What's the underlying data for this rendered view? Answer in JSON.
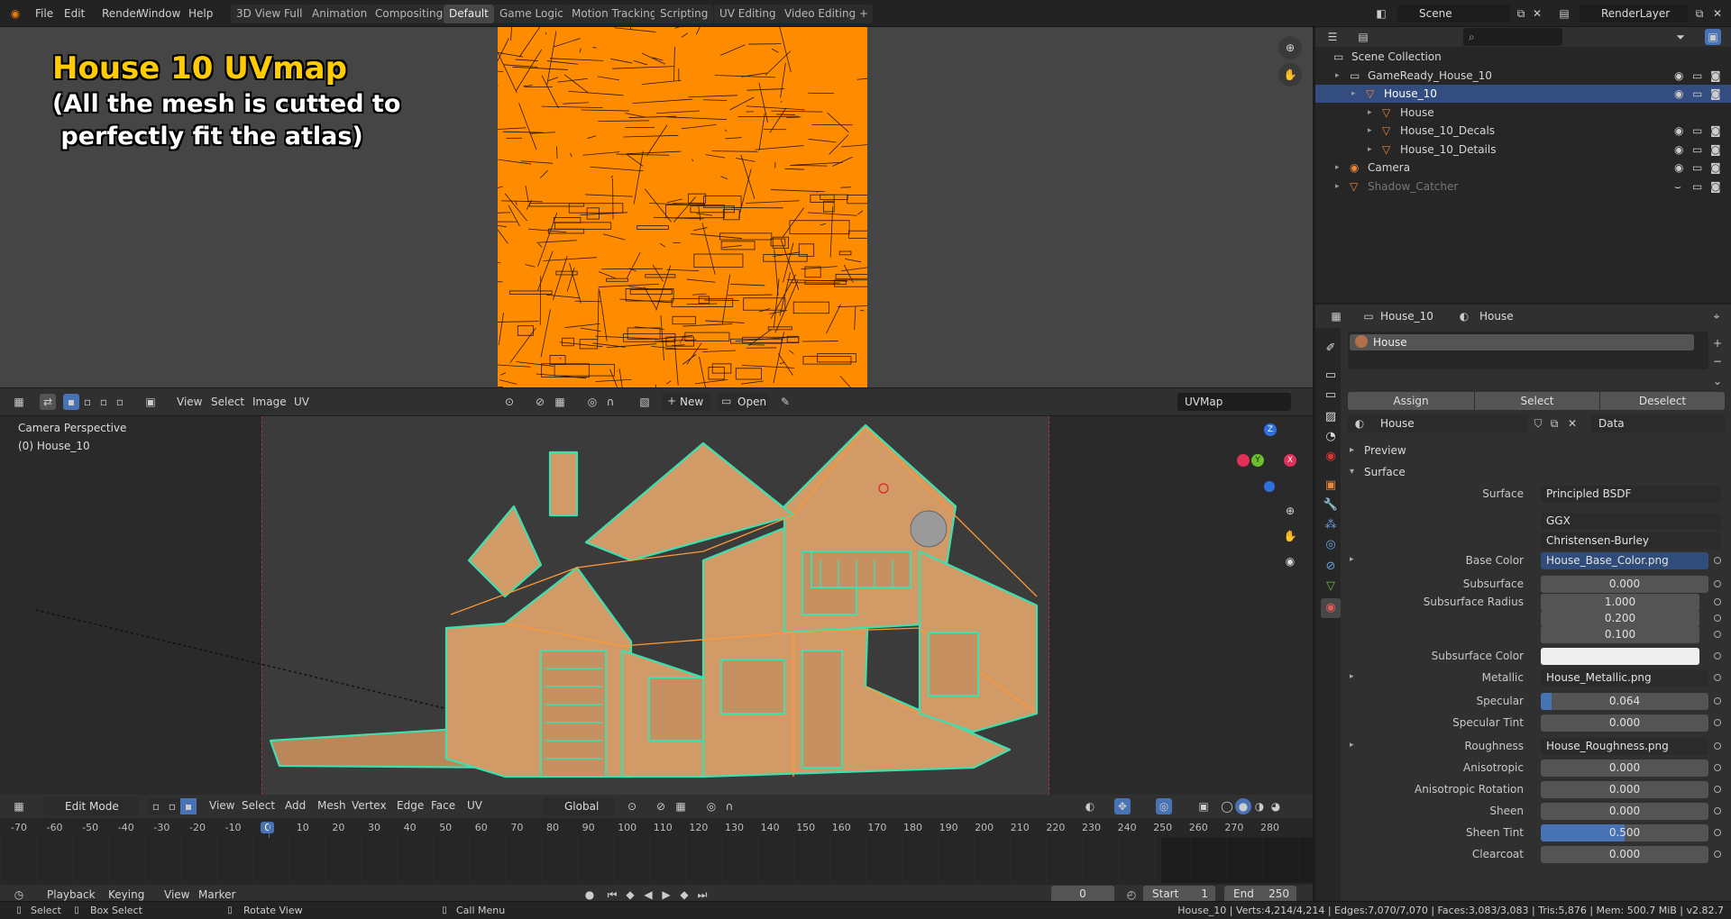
{
  "topbar": {
    "menus": [
      "File",
      "Edit",
      "Render",
      "Window",
      "Help"
    ],
    "workspaces": [
      "3D View Full",
      "Animation",
      "Compositing",
      "Default",
      "Game Logic",
      "Motion Tracking",
      "Scripting",
      "UV Editing",
      "Video Editing"
    ],
    "active_workspace": "Default",
    "add_workspace": "+",
    "scene": "Scene",
    "render_layer": "RenderLayer"
  },
  "overlay": {
    "title": "House 10 UVmap",
    "line1": "(All the mesh is cutted to",
    "line2": " perfectly fit the atlas)"
  },
  "uv_header": {
    "menus": [
      "View",
      "Select",
      "Image",
      "UV"
    ],
    "new_label": "New",
    "open_label": "Open",
    "uvmap": "UVMap"
  },
  "viewport": {
    "view_name": "Camera Perspective",
    "object_name": "(0) House_10",
    "gizmo_axes": [
      "Z",
      "Y",
      "X"
    ]
  },
  "vp_header": {
    "mode": "Edit Mode",
    "menus": [
      "View",
      "Select",
      "Add",
      "Mesh",
      "Vertex",
      "Edge",
      "Face",
      "UV"
    ],
    "orientation": "Global"
  },
  "timeline": {
    "ticks": [
      "-70",
      "-60",
      "-50",
      "-40",
      "-30",
      "-20",
      "-10",
      "0",
      "10",
      "20",
      "30",
      "40",
      "50",
      "60",
      "70",
      "80",
      "90",
      "100",
      "110",
      "120",
      "130",
      "140",
      "150",
      "160",
      "170",
      "180",
      "190",
      "200",
      "210",
      "220",
      "230",
      "240",
      "250",
      "260",
      "270",
      "280"
    ],
    "current_frame": "0",
    "menus": [
      "Playback",
      "Keying",
      "View",
      "Marker"
    ],
    "frame_value": "0",
    "start_label": "Start",
    "start_value": "1",
    "end_label": "End",
    "end_value": "250"
  },
  "statusbar": {
    "select": "Select",
    "box_select": "Box Select",
    "rotate_view": "Rotate View",
    "call_menu": "Call Menu",
    "stats": "House_10 | Verts:4,214/4,214 | Edges:7,070/7,070 | Faces:3,083/3,083 | Tris:5,876 | Mem: 500.7 MiB | v2.82.7"
  },
  "outliner": {
    "search_placeholder": "",
    "rows": [
      {
        "label": "Scene Collection",
        "indent": 0
      },
      {
        "label": "GameReady_House_10",
        "indent": 1
      },
      {
        "label": "House_10",
        "indent": 2,
        "selected": true
      },
      {
        "label": "House",
        "indent": 3
      },
      {
        "label": "House_10_Decals",
        "indent": 3
      },
      {
        "label": "House_10_Details",
        "indent": 3
      },
      {
        "label": "Camera",
        "indent": 1
      },
      {
        "label": "Shadow_Catcher",
        "indent": 1,
        "muted": true
      }
    ]
  },
  "props": {
    "breadcrumb_object": "House_10",
    "breadcrumb_material": "House",
    "slot_name": "House",
    "assign": "Assign",
    "select": "Select",
    "deselect": "Deselect",
    "material_name": "House",
    "link_mode": "Data",
    "preview_label": "Preview",
    "surface_section": "Surface",
    "surface_label": "Surface",
    "surface_shader": "Principled BSDF",
    "distribution": "GGX",
    "subsurface_method": "Christensen-Burley",
    "rows": [
      {
        "label": "Base Color",
        "value": "House_Base_Color.png",
        "kind": "sel",
        "expand": true
      },
      {
        "label": "Subsurface",
        "value": "0.000",
        "kind": "num"
      },
      {
        "label": "Subsurface Radius",
        "value": "1.000",
        "kind": "num"
      },
      {
        "label": "",
        "value": "0.200",
        "kind": "num"
      },
      {
        "label": "",
        "value": "0.100",
        "kind": "num"
      },
      {
        "label": "Subsurface Color",
        "value": "",
        "kind": "color"
      },
      {
        "label": "Metallic",
        "value": "House_Metallic.png",
        "kind": "txt",
        "expand": true
      },
      {
        "label": "Specular",
        "value": "0.064",
        "kind": "num",
        "fill": 0.064
      },
      {
        "label": "Specular Tint",
        "value": "0.000",
        "kind": "num"
      },
      {
        "label": "Roughness",
        "value": "House_Roughness.png",
        "kind": "txt",
        "expand": true
      },
      {
        "label": "Anisotropic",
        "value": "0.000",
        "kind": "num"
      },
      {
        "label": "Anisotropic Rotation",
        "value": "0.000",
        "kind": "num"
      },
      {
        "label": "Sheen",
        "value": "0.000",
        "kind": "num"
      },
      {
        "label": "Sheen Tint",
        "value": "0.500",
        "kind": "num",
        "fill": 0.5
      },
      {
        "label": "Clearcoat",
        "value": "0.000",
        "kind": "num"
      }
    ]
  },
  "colors": {
    "uv_orange": "#ff8c00",
    "mesh_cyan": "#3fe0b0",
    "house_tan": "#d29a66",
    "title_yellow": "#ffcc00",
    "selection_blue": "#334d80",
    "accent_blue": "#4772b3"
  }
}
